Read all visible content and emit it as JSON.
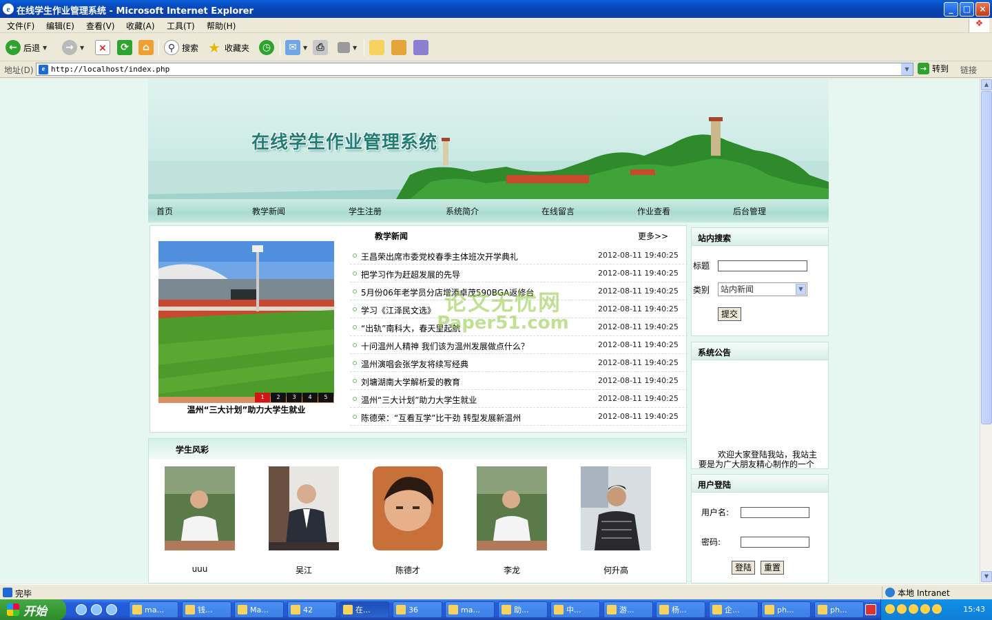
{
  "window": {
    "title": "在线学生作业管理系统 - Microsoft Internet Explorer",
    "minimize": "_",
    "maximize": "□",
    "close": "×"
  },
  "menubar": {
    "items": [
      "文件(F)",
      "编辑(E)",
      "查看(V)",
      "收藏(A)",
      "工具(T)",
      "帮助(H)"
    ]
  },
  "toolbar": {
    "back": "后退",
    "search": "搜索",
    "favorites": "收藏夹"
  },
  "address": {
    "label": "地址(D)",
    "url": "http://localhost/index.php",
    "go": "转到",
    "links": "链接"
  },
  "site": {
    "title": "在线学生作业管理系统",
    "nav": [
      "首页",
      "教学新闻",
      "学生注册",
      "系统简介",
      "在线留言",
      "作业查看",
      "后台管理"
    ]
  },
  "news": {
    "title": "教学新闻",
    "more": "更多>>",
    "slide_caption": "温州“三大计划”助力大学生就业",
    "slide_numbers": [
      "1",
      "2",
      "3",
      "4",
      "5"
    ],
    "items": [
      {
        "text": "王昌荣出席市委党校春季主体班次开学典礼",
        "date": "2012-08-11 19:40:25"
      },
      {
        "text": "把学习作为赶超发展的先导",
        "date": "2012-08-11 19:40:25"
      },
      {
        "text": "5月份06年老学员分店增添卓茂590BGA返修台",
        "date": "2012-08-11 19:40:25"
      },
      {
        "text": "学习《江泽民文选》",
        "date": "2012-08-11 19:40:25"
      },
      {
        "text": "“出轨”南科大，春天里起航",
        "date": "2012-08-11 19:40:25"
      },
      {
        "text": "十问温州人精神 我们该为温州发展做点什么？",
        "date": "2012-08-11 19:40:25"
      },
      {
        "text": "温州演唱会张学友将续写经典",
        "date": "2012-08-11 19:40:25"
      },
      {
        "text": "刘墉湖南大学解析爱的教育",
        "date": "2012-08-11 19:40:25"
      },
      {
        "text": "温州“三大计划”助力大学生就业",
        "date": "2012-08-11 19:40:25"
      },
      {
        "text": "陈德荣：“互看互学”比干劲 转型发展新温州",
        "date": "2012-08-11 19:40:25"
      }
    ]
  },
  "watermark": {
    "line1": "论文无忧网",
    "line2": "Paper51.com"
  },
  "students": {
    "title": "学生风彩",
    "list": [
      {
        "name": "uuu"
      },
      {
        "name": "吴江"
      },
      {
        "name": "陈德才"
      },
      {
        "name": "李龙"
      },
      {
        "name": "何升高"
      }
    ]
  },
  "search_panel": {
    "title": "站内搜索",
    "title_label": "标题",
    "category_label": "类别",
    "category_value": "站内新闻",
    "submit": "提交"
  },
  "notice_panel": {
    "title": "系统公告",
    "text": "欢迎大家登陆我站，我站主要是为广大朋友精心制作的一个"
  },
  "login_panel": {
    "title": "用户登陆",
    "username_label": "用户名:",
    "password_label": "密码:",
    "login": "登陆",
    "reset": "重置"
  },
  "statusbar": {
    "text": "完毕",
    "zone": "本地 Intranet"
  },
  "taskbar": {
    "start": "开始",
    "tasks": [
      "ma...",
      "钱...",
      "Ma...",
      "42",
      "在...",
      "36",
      "ma...",
      "助...",
      "中...",
      "游...",
      "杨...",
      "企...",
      "ph...",
      "ph..."
    ],
    "active_index": 4,
    "clock": "15:43"
  }
}
